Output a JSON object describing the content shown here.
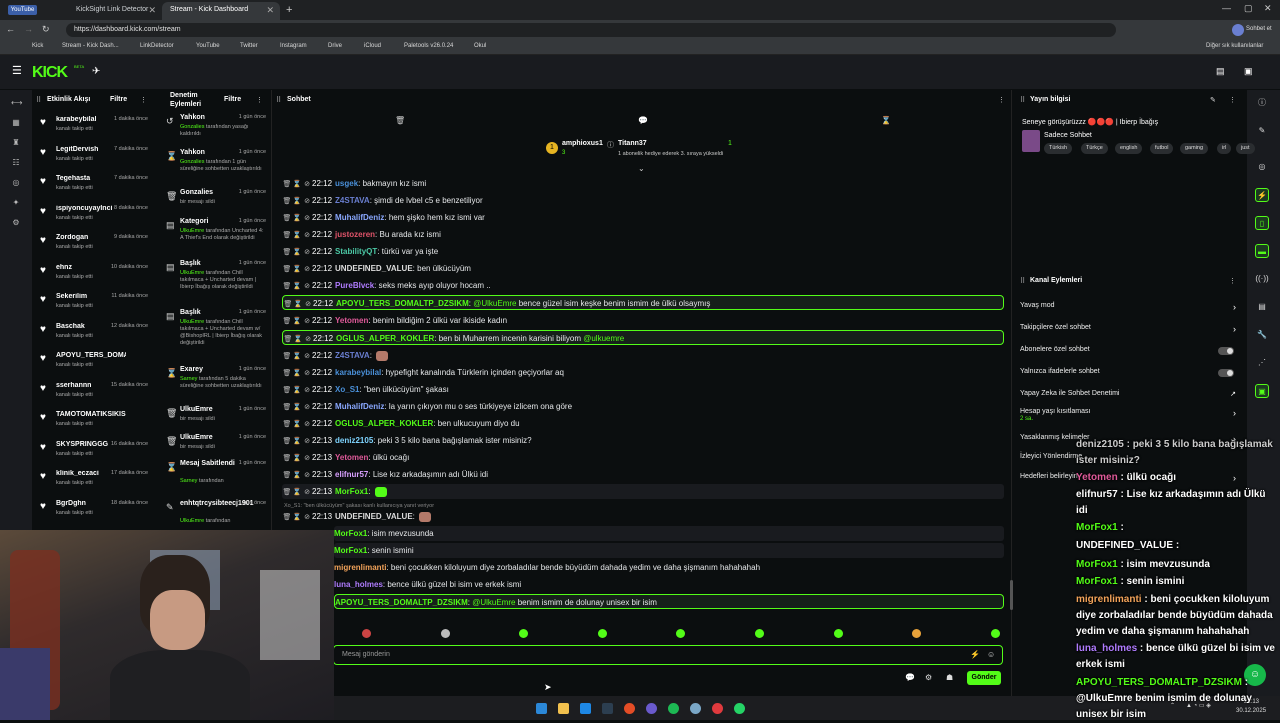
{
  "browser": {
    "tabs": [
      {
        "label": "YouTube"
      },
      {
        "label": "KickSight Link Detector"
      },
      {
        "label": "Stream - Kick Dashboard"
      }
    ],
    "url": "https://dashboard.kick.com/stream",
    "profile": "Sohbet et",
    "bookmarks": [
      "Kick",
      "Stream - Kick Dash...",
      "LinkDetector",
      "YouTube",
      "Twitter",
      "Instagram",
      "Drive",
      "iCloud",
      "Paletools v26.0.24",
      "Okul"
    ],
    "other_bookmarks": "Diğer sık kullanılanlar"
  },
  "app": {
    "logo": "KICK",
    "logo_sup": "BETA"
  },
  "activity": {
    "title": "Etkinlik Akışı",
    "filter": "Filtre",
    "items": [
      {
        "name": "karabeybilal",
        "sub": "kanalı takip etti",
        "time": "1 dakika önce"
      },
      {
        "name": "LegitDervish",
        "sub": "kanalı takip etti",
        "time": "7 dakika önce"
      },
      {
        "name": "Tegehasta",
        "sub": "kanalı takip etti",
        "time": "7 dakika önce"
      },
      {
        "name": "ispiyoncuyaylnci",
        "sub": "kanalı takip etti",
        "time": "8 dakika önce"
      },
      {
        "name": "Zordogan",
        "sub": "kanalı takip etti",
        "time": "9 dakika önce"
      },
      {
        "name": "ehnz",
        "sub": "kanalı takip etti",
        "time": "10 dakika önce"
      },
      {
        "name": "Sekerilim",
        "sub": "kanalı takip etti",
        "time": "11 dakika önce"
      },
      {
        "name": "Baschak",
        "sub": "kanalı takip etti",
        "time": "12 dakika önce"
      },
      {
        "name": "APOYU_TERS_DOMALTP_D",
        "sub": "kanalı takip etti",
        "time": ""
      },
      {
        "name": "sserhannn",
        "sub": "kanalı takip etti",
        "time": "15 dakika önce"
      },
      {
        "name": "TAMOTOMATIKSIKISMAKII",
        "sub": "kanalı takip etti",
        "time": ""
      },
      {
        "name": "SKYSPRINGGG",
        "sub": "kanalı takip etti",
        "time": "16 dakika önce"
      },
      {
        "name": "klinik_eczaci",
        "sub": "kanalı takip etti",
        "time": "17 dakika önce"
      },
      {
        "name": "BgrDghn",
        "sub": "kanalı takip etti",
        "time": "18 dakika önce"
      }
    ]
  },
  "moderation": {
    "title": "Denetim Eylemleri",
    "filter": "Filtre",
    "items": [
      {
        "icon": "↺",
        "name": "Yahkon",
        "user": "Gonzalies",
        "sub": "tarafından yasağı kaldırıldı",
        "time": "1 gün önce"
      },
      {
        "icon": "⌛",
        "name": "Yahkon",
        "user": "Gonzalies",
        "sub": "tarafından 1 gün süreliğine sohbetten uzaklaştırıldı",
        "time": "1 gün önce"
      },
      {
        "icon": "🗑",
        "name": "Gonzalies",
        "user": "",
        "sub": "bir mesajı sildi",
        "time": "1 gün önce"
      },
      {
        "icon": "▤",
        "name": "Kategori",
        "user": "UlkuEmre",
        "sub": "tarafından Uncharted 4: A Thief's End olarak değiştirildi",
        "time": "1 gün önce"
      },
      {
        "icon": "▤",
        "name": "Başlık",
        "user": "UlkuEmre",
        "sub": "tarafından Chill takılmaca + Uncharted devam | Ibierp İbağış olarak değiştirildi",
        "time": "1 gün önce"
      },
      {
        "icon": "▤",
        "name": "Başlık",
        "user": "UlkuEmre",
        "sub": "tarafından Chill takılmaca + Uncharted devam w/ @BishopIRL | Ibierp İbağış olarak değiştirildi",
        "time": "1 gün önce"
      },
      {
        "icon": "⌛",
        "name": "Exarey",
        "user": "Sarney",
        "sub": "tarafından 5 dakika süreliğine sohbetten uzaklaştırıldı",
        "time": "1 gün önce"
      },
      {
        "icon": "🗑",
        "name": "UlkuEmre",
        "user": "",
        "sub": "bir mesajı sildi",
        "time": "1 gün önce"
      },
      {
        "icon": "🗑",
        "name": "UlkuEmre",
        "user": "",
        "sub": "bir mesajı sildi",
        "time": "1 gün önce"
      },
      {
        "icon": "⌛",
        "name": "Mesaj Sabitlendi",
        "user": "Sarney",
        "sub": "tarafından",
        "time": "1 gün önce"
      },
      {
        "icon": "✎",
        "name": "enhtqtrcysibteecj1901",
        "user": "UlkuEmre",
        "sub": "tarafından",
        "time": "1 gün önce"
      }
    ]
  },
  "chat": {
    "title": "Sohbet",
    "top_gifter": {
      "name": "amphioxus1",
      "count": "3"
    },
    "gift_notice": {
      "name": "Titann37",
      "badge": "1",
      "text": "1 abonelik hediye ederek 3. sıraya yükseldi"
    },
    "reply_hint": "Xo_S1: \"ben ülkücüyüm\" şakası kanlı kullanıcıya yanıt veriyor",
    "messages": [
      {
        "time": "22:12",
        "user": "usgek",
        "color": "#4a90d9",
        "text": "bakmayın kız ismi",
        "hl": false
      },
      {
        "time": "22:12",
        "user": "Z4STAVA",
        "color": "#6a7fd1",
        "text": "şimdi de lvbel c5 e benzetiliyor",
        "hl": false
      },
      {
        "time": "22:12",
        "user": "MuhalifDeniz",
        "color": "#8aa8ff",
        "text": "hem şişko hem kız ismi var",
        "hl": false
      },
      {
        "time": "22:12",
        "user": "justozeren",
        "color": "#e0546a",
        "text": "Bu arada kız ismi",
        "hl": false
      },
      {
        "time": "22:12",
        "user": "StabilityQT",
        "color": "#4cc9a6",
        "text": "türkü var ya işte",
        "hl": false
      },
      {
        "time": "22:12",
        "user": "UNDEFINED_VALUE",
        "color": "#dddddd",
        "text": "ben ülkücüyüm",
        "hl": false
      },
      {
        "time": "22:12",
        "user": "PureBlvck",
        "color": "#b07cff",
        "text": "seks meks ayıp oluyor hocam ..",
        "hl": false
      },
      {
        "time": "22:12",
        "user": "APOYU_TERS_DOMALTP_DZSIKM",
        "color": "#53fc18",
        "mention": "@UlkuEmre",
        "text": "bence güzel isim keşke benim ismim de ülkü olsaymış",
        "hl": true
      },
      {
        "time": "22:12",
        "user": "Yetomen",
        "color": "#e05a9a",
        "text": "benim bildiğim 2 ülkü var ikiside kadın",
        "hl": false
      },
      {
        "time": "22:12",
        "user": "OGLUS_ALPER_KOKLER",
        "color": "#53fc18",
        "text": "ben bi Muharrem incenin karisini biliyom",
        "mention_end": "@ulkuemre",
        "hl": true
      },
      {
        "time": "22:12",
        "user": "Z4STAVA",
        "color": "#6a7fd1",
        "text": "",
        "hl": false,
        "emote": true
      },
      {
        "time": "22:12",
        "user": "karabeybilal",
        "color": "#4a90d9",
        "text": "hypefight kanalında Türklerin içinden geçiyorlar aq",
        "hl": false
      },
      {
        "time": "22:12",
        "user": "Xo_S1",
        "color": "#4a90d9",
        "text": "\"ben ülkücüyüm\" şakası",
        "hl": false
      },
      {
        "time": "22:12",
        "user": "MuhalifDeniz",
        "color": "#8aa8ff",
        "text": "la yarın çıkıyon mu o ses türkiyeye izlicem ona göre",
        "hl": false
      },
      {
        "time": "22:12",
        "user": "OGLUS_ALPER_KOKLER",
        "color": "#53fc18",
        "text": "ben ulkucuyum diyo du",
        "hl": false
      },
      {
        "time": "22:13",
        "user": "deniz2105",
        "color": "#7fd4ff",
        "text": "peki 3 5 kilo bana bağışlamak ister misiniz?",
        "hl": false
      },
      {
        "time": "22:13",
        "user": "Yetomen",
        "color": "#e05a9a",
        "text": "ülkü ocağı",
        "hl": false
      },
      {
        "time": "22:13",
        "user": "elifnur57",
        "color": "#d9a0ff",
        "text": "Lise kız arkadaşımın adı Ülkü idi",
        "hl": false
      },
      {
        "time": "22:13",
        "user": "MorFox1",
        "color": "#53fc18",
        "text": "",
        "hl": false,
        "box": true,
        "emote": true
      },
      {
        "time": "22:13",
        "user": "UNDEFINED_VALUE",
        "color": "#dddddd",
        "text": "",
        "hl": false,
        "emote": true
      },
      {
        "time": "",
        "user": "MorFox1",
        "color": "#53fc18",
        "text": "isim mevzusunda",
        "hl": false,
        "box": true
      },
      {
        "time": "",
        "user": "MorFox1",
        "color": "#53fc18",
        "text": "senin ismini",
        "hl": false,
        "box": true
      },
      {
        "time": "",
        "user": "migrenlimanti",
        "color": "#f2a35a",
        "text": "beni çocukken kiloluyum diye zorbaladılar bende büyüdüm dahada yedim ve daha şişmanım hahahahah",
        "hl": false
      },
      {
        "time": "",
        "user": "luna_holmes",
        "color": "#b07cff",
        "text": "bence ülkü güzel bi isim ve erkek ismi",
        "hl": false
      },
      {
        "time": "",
        "user": "APOYU_TERS_DOMALTP_DZSIKM",
        "color": "#53fc18",
        "mention": "@UlkuEmre",
        "text": "benim ismim de dolunay unisex bir isim",
        "hl": true
      }
    ],
    "input_placeholder": "Mesaj gönderin",
    "send_label": "Gönder"
  },
  "stream_info": {
    "title": "Yayın bilgisi",
    "stream_title": "Seneye görüşürüzzz 🔴🔴🔴 | Ibierp İbağış",
    "mode": "Sadece Sohbet",
    "tags": [
      "Türkish",
      "Türkçe",
      "english",
      "futbol",
      "gaming",
      "irl",
      "just"
    ]
  },
  "channel_actions": {
    "title": "Kanal Eylemleri",
    "rows": [
      {
        "label": "Yavaş mod",
        "kind": "arrow"
      },
      {
        "label": "Takipçilere özel sohbet",
        "kind": "arrow"
      },
      {
        "label": "Abonelere özel sohbet",
        "kind": "toggle"
      },
      {
        "label": "Yalnızca ifadelerle sohbet",
        "kind": "toggle"
      },
      {
        "label": "Yapay Zeka ile Sohbet Denetimi",
        "kind": "link"
      },
      {
        "label": "Hesap yaşı kısıtlaması",
        "sub": "2 sa.",
        "kind": "arrow"
      },
      {
        "label": "Yasaklanmış kelimeler",
        "kind": "arrow"
      },
      {
        "label": "İzleyici Yönlendirme",
        "kind": "none"
      },
      {
        "label": "Hedefleri belirleyin",
        "kind": "arrow"
      }
    ]
  },
  "overlay_chat": [
    {
      "user": "",
      "text": "deniz2105 : peki 3 5 kilo bana bağışlamak ister misiniz?"
    },
    {
      "user": "Yetomen",
      "text": ": ülkü ocağı"
    },
    {
      "user": "elifnur57",
      "text": ": Lise kız arkadaşımın adı Ülkü idi"
    },
    {
      "user": "MorFox1",
      "text": ":"
    },
    {
      "user": "UNDEFINED_VALUE",
      "text": ":"
    },
    {
      "user": "MorFox1",
      "text": ": isim mevzusunda"
    },
    {
      "user": "MorFox1",
      "text": ": senin ismini"
    },
    {
      "user": "migrenlimanti",
      "text": ": beni çocukken kiloluyum diye zorbaladılar bende büyüdüm dahada yedim ve daha şişmanım hahahahah"
    },
    {
      "user": "luna_holmes",
      "text": ": bence ülkü güzel bi isim ve erkek ismi"
    },
    {
      "user": "APOYU_TERS_DOMALTP_DZSIKM",
      "text": ": @UlkuEmre benim ismim de dolunay unisex bir isim"
    }
  ],
  "taskbar": {
    "time": "22:13",
    "date": "30.12.2025"
  },
  "colors": {
    "accent": "#53fc18",
    "bg": "#0b0e0f",
    "panel": "#191b1f"
  }
}
